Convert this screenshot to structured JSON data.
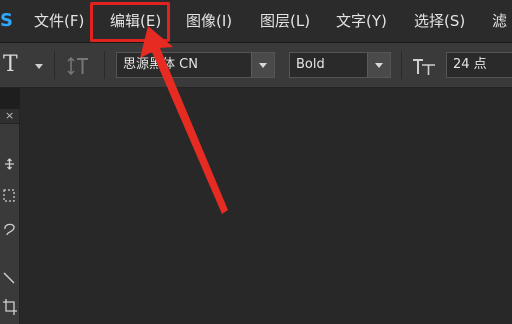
{
  "menubar": {
    "logo": "S",
    "items": [
      {
        "label": "文件(F)"
      },
      {
        "label": "编辑(E)"
      },
      {
        "label": "图像(I)"
      },
      {
        "label": "图层(L)"
      },
      {
        "label": "文字(Y)"
      },
      {
        "label": "选择(S)"
      },
      {
        "label": "滤"
      }
    ]
  },
  "options": {
    "tool_glyph": "T",
    "font_family": "思源黑体 CN",
    "font_style": "Bold",
    "font_size": "24 点"
  },
  "toolbar": {
    "close": "×"
  },
  "annotation": {
    "highlight_color": "#e1231f"
  }
}
